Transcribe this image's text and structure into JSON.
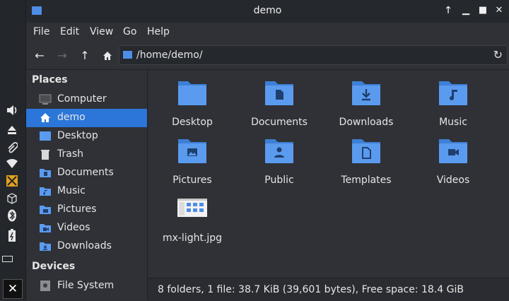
{
  "window": {
    "title": "demo"
  },
  "menu": [
    "File",
    "Edit",
    "View",
    "Go",
    "Help"
  ],
  "toolbar": {
    "path": "/home/demo/"
  },
  "sidebar": {
    "places_heading": "Places",
    "devices_heading": "Devices",
    "places": [
      {
        "label": "Computer",
        "icon": "computer-icon"
      },
      {
        "label": "demo",
        "icon": "home-icon",
        "active": true
      },
      {
        "label": "Desktop",
        "icon": "desktop-folder-icon"
      },
      {
        "label": "Trash",
        "icon": "trash-icon"
      },
      {
        "label": "Documents",
        "icon": "documents-folder-icon"
      },
      {
        "label": "Music",
        "icon": "music-folder-icon"
      },
      {
        "label": "Pictures",
        "icon": "pictures-folder-icon"
      },
      {
        "label": "Videos",
        "icon": "videos-folder-icon"
      },
      {
        "label": "Downloads",
        "icon": "downloads-folder-icon"
      }
    ],
    "devices": [
      {
        "label": "File System",
        "icon": "drive-icon"
      }
    ]
  },
  "files": [
    {
      "label": "Desktop",
      "icon": "desktop-folder-icon"
    },
    {
      "label": "Documents",
      "icon": "documents-folder-icon"
    },
    {
      "label": "Downloads",
      "icon": "downloads-folder-icon"
    },
    {
      "label": "Music",
      "icon": "music-folder-icon"
    },
    {
      "label": "Pictures",
      "icon": "pictures-folder-icon"
    },
    {
      "label": "Public",
      "icon": "public-folder-icon"
    },
    {
      "label": "Templates",
      "icon": "templates-folder-icon"
    },
    {
      "label": "Videos",
      "icon": "videos-folder-icon"
    },
    {
      "label": "mx-light.jpg",
      "icon": "image-thumbnail-icon"
    }
  ],
  "status": {
    "text": "8 folders, 1 file: 38.7 KiB (39,601 bytes), Free space: 18.4 GiB"
  },
  "colors": {
    "accent": "#2b76d8",
    "folder": "#5b9bef",
    "background": "#2f3136"
  }
}
